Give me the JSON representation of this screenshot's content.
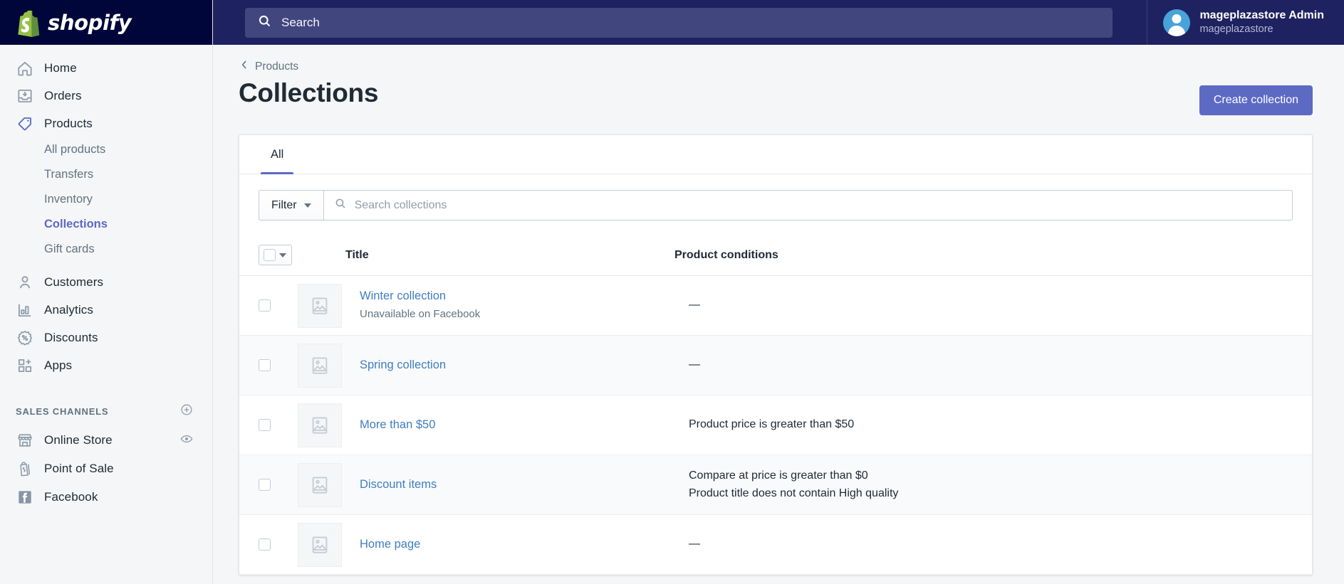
{
  "brand": {
    "name": "shopify",
    "logo_icon": "shopify-bag-logo",
    "accent": "#5c6ac4",
    "topbar_bg": "#1f2260",
    "logo_bg": "#000639"
  },
  "topbar": {
    "search": {
      "placeholder": "Search",
      "icon": "search-icon"
    },
    "user": {
      "name": "mageplazastore Admin",
      "store": "mageplazastore",
      "avatar_icon": "user-avatar-icon"
    }
  },
  "sidebar": {
    "items": [
      {
        "label": "Home",
        "icon": "home-icon"
      },
      {
        "label": "Orders",
        "icon": "orders-inbox-icon"
      },
      {
        "label": "Products",
        "icon": "products-tag-icon"
      }
    ],
    "sub_items": [
      {
        "label": "All products"
      },
      {
        "label": "Transfers"
      },
      {
        "label": "Inventory"
      },
      {
        "label": "Collections",
        "current": true
      },
      {
        "label": "Gift cards"
      }
    ],
    "items2": [
      {
        "label": "Customers",
        "icon": "customers-person-icon"
      },
      {
        "label": "Analytics",
        "icon": "analytics-bar-chart-icon"
      },
      {
        "label": "Discounts",
        "icon": "discounts-percent-badge-icon"
      },
      {
        "label": "Apps",
        "icon": "apps-grid-plus-icon"
      }
    ],
    "section": {
      "title": "SALES CHANNELS",
      "add_icon": "plus-circle-icon"
    },
    "channels": [
      {
        "label": "Online Store",
        "icon": "online-store-icon",
        "action_icon": "eye-icon"
      },
      {
        "label": "Point of Sale",
        "icon": "point-of-sale-icon"
      },
      {
        "label": "Facebook",
        "icon": "facebook-icon"
      }
    ]
  },
  "page": {
    "breadcrumb": {
      "label": "Products",
      "icon": "chevron-left-icon"
    },
    "title": "Collections",
    "primary_action": "Create collection"
  },
  "card": {
    "tabs": [
      {
        "label": "All",
        "active": true
      }
    ],
    "filter": {
      "label": "Filter",
      "caret_icon": "chevron-down-icon"
    },
    "search": {
      "placeholder": "Search collections",
      "icon": "search-icon"
    },
    "table": {
      "columns": {
        "title": "Title",
        "conditions": "Product conditions"
      },
      "rows": [
        {
          "title": "Winter collection",
          "subtitle": "Unavailable on Facebook",
          "conditions": [
            "—"
          ],
          "thumb_icon": "image-placeholder-icon"
        },
        {
          "title": "Spring collection",
          "subtitle": "",
          "conditions": [
            "—"
          ],
          "thumb_icon": "image-placeholder-icon"
        },
        {
          "title": "More than $50",
          "subtitle": "",
          "conditions": [
            "Product price is greater than $50"
          ],
          "thumb_icon": "image-placeholder-icon"
        },
        {
          "title": "Discount items",
          "subtitle": "",
          "conditions": [
            "Compare at price is greater than $0",
            "Product title does not contain High quality"
          ],
          "thumb_icon": "image-placeholder-icon"
        },
        {
          "title": "Home page",
          "subtitle": "",
          "conditions": [
            "—"
          ],
          "thumb_icon": "image-placeholder-icon"
        }
      ]
    }
  }
}
